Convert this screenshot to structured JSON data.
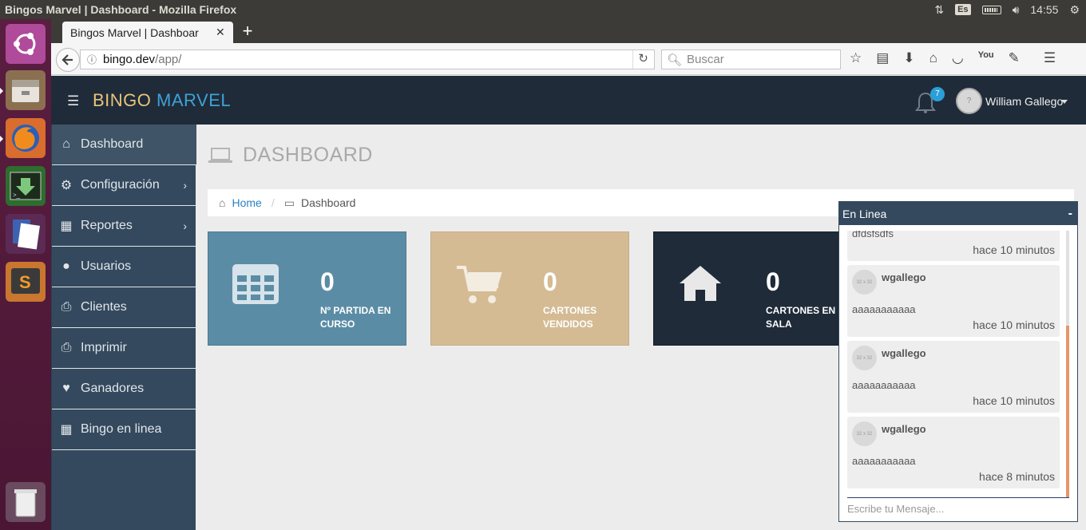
{
  "os": {
    "window_title": "Bingos Marvel | Dashboard - Mozilla Firefox",
    "keyboard": "Es",
    "clock": "14:55"
  },
  "browser": {
    "tab_title": "Bingos Marvel | Dashboar",
    "url_host": "bingo.dev",
    "url_path": "/app/",
    "search_placeholder": "Buscar"
  },
  "app": {
    "brand_part1": "BINGO",
    "brand_part2": "MARVEL",
    "notifications_count": "7",
    "user_name": "William Gallego",
    "avatar_text": "?"
  },
  "sidebar": {
    "items": [
      {
        "label": "Dashboard"
      },
      {
        "label": "Configuración"
      },
      {
        "label": "Reportes"
      },
      {
        "label": "Usuarios"
      },
      {
        "label": "Clientes"
      },
      {
        "label": "Imprimir"
      },
      {
        "label": "Ganadores"
      },
      {
        "label": "Bingo en linea"
      }
    ]
  },
  "page": {
    "title": "DASHBOARD",
    "breadcrumb_home": "Home",
    "breadcrumb_current": "Dashboard"
  },
  "cards": [
    {
      "value": "0",
      "label": "Nº PARTIDA EN CURSO",
      "color": "#5b8ca5"
    },
    {
      "value": "0",
      "label": "CARTONES VENDIDOS",
      "color": "#d4bb94"
    },
    {
      "value": "0",
      "label": "CARTONES EN SALA",
      "color": "#1f2b39"
    }
  ],
  "chat": {
    "title": "En Linea",
    "minimize": "-",
    "avatar_text": "32 x 32",
    "messages": [
      {
        "user": "",
        "text": "dfdsfsdfs",
        "time": "hace 10 minutos"
      },
      {
        "user": "wgallego",
        "text": "aaaaaaaaaaa",
        "time": "hace 10 minutos"
      },
      {
        "user": "wgallego",
        "text": "aaaaaaaaaaa",
        "time": "hace 10 minutos"
      },
      {
        "user": "wgallego",
        "text": "aaaaaaaaaaa",
        "time": "hace 8 minutos"
      }
    ],
    "input_placeholder": "Escribe tu Mensaje..."
  }
}
